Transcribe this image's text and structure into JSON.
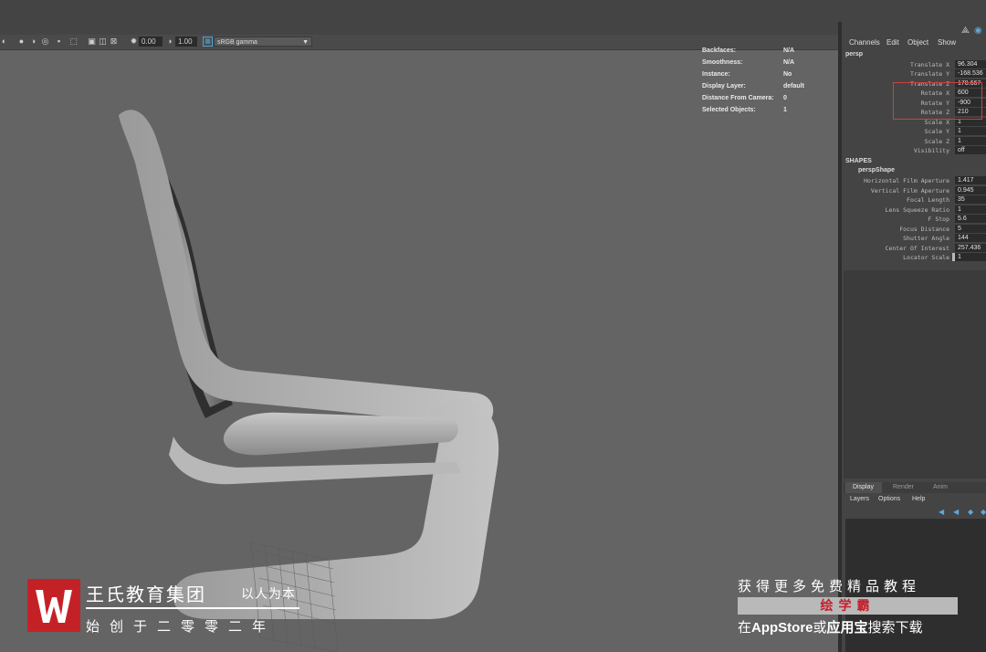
{
  "toolbar": {
    "exposure_value": "0.00",
    "gamma_value": "1.00",
    "color_space": "sRGB gamma"
  },
  "hud": [
    {
      "label": "Backfaces:",
      "value": "N/A"
    },
    {
      "label": "Smoothness:",
      "value": "N/A"
    },
    {
      "label": "Instance:",
      "value": "No"
    },
    {
      "label": "Display Layer:",
      "value": "default"
    },
    {
      "label": "Distance From Camera:",
      "value": "0"
    },
    {
      "label": "Selected Objects:",
      "value": "1"
    }
  ],
  "channel_box": {
    "menus": [
      "Channels",
      "Edit",
      "Object",
      "Show"
    ],
    "node_name": "persp",
    "transform_attrs": [
      {
        "label": "Translate X",
        "value": "96.304"
      },
      {
        "label": "Translate Y",
        "value": "-168.536"
      },
      {
        "label": "Translate Z",
        "value": "178.667"
      },
      {
        "label": "Rotate X",
        "value": "600"
      },
      {
        "label": "Rotate Y",
        "value": "-900"
      },
      {
        "label": "Rotate Z",
        "value": "210"
      },
      {
        "label": "Scale X",
        "value": "1"
      },
      {
        "label": "Scale Y",
        "value": "1"
      },
      {
        "label": "Scale Z",
        "value": "1"
      },
      {
        "label": "Visibility",
        "value": "off"
      }
    ],
    "shapes_header": "SHAPES",
    "shape_name": "perspShape",
    "shape_attrs": [
      {
        "label": "Horizontal Film Aperture",
        "value": "1.417"
      },
      {
        "label": "Vertical Film Aperture",
        "value": "0.945"
      },
      {
        "label": "Focal Length",
        "value": "35"
      },
      {
        "label": "Lens Squeeze Ratio",
        "value": "1"
      },
      {
        "label": "F Stop",
        "value": "5.6"
      },
      {
        "label": "Focus Distance",
        "value": "5"
      },
      {
        "label": "Shutter Angle",
        "value": "144"
      },
      {
        "label": "Center Of Interest",
        "value": "257.436"
      },
      {
        "label": "Locator Scale",
        "value": "1"
      }
    ]
  },
  "layer_editor": {
    "tabs": [
      "Display",
      "Render",
      "Anim"
    ],
    "menus": [
      "Layers",
      "Options",
      "Help"
    ]
  },
  "watermark": {
    "brand_name": "王氏教育集团",
    "motto": "以人为本",
    "since": "始创于二零零二年",
    "promo_line1": "获得更多免费精品教程",
    "promo_app": "绘学霸",
    "promo_line3_a": "在",
    "promo_line3_b": "AppStore",
    "promo_line3_c": "或",
    "promo_line3_d": "应用宝",
    "promo_line3_e": "搜索下载",
    "brand_color": "#c42127"
  }
}
